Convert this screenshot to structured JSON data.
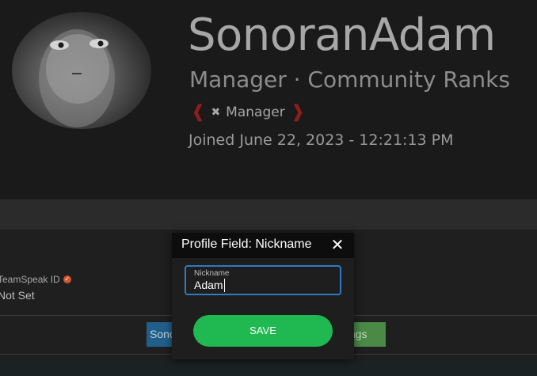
{
  "profile": {
    "username": "SonoranAdam",
    "subtitle": "Manager · Community Ranks",
    "rank_badge": "Manager",
    "joined": "Joined June 22, 2023 - 12:21:13 PM"
  },
  "fields": {
    "teamspeak_label": "TeamSpeak ID",
    "teamspeak_value": "Not Set"
  },
  "buttons": {
    "left_partial": "Sono",
    "right_partial": "ttings"
  },
  "modal": {
    "title": "Profile Field: Nickname",
    "input_label": "Nickname",
    "input_value": "Adam",
    "save_label": "SAVE",
    "close_glyph": "✕"
  },
  "colors": {
    "accent_blue": "#2f7ac2",
    "save_green": "#1fb851",
    "rank_red": "#8c1d1d",
    "verified_orange": "#d0562b"
  },
  "icons": {
    "rank": "crossed-arrows-icon",
    "verified": "check-badge-icon",
    "close": "close-icon"
  }
}
